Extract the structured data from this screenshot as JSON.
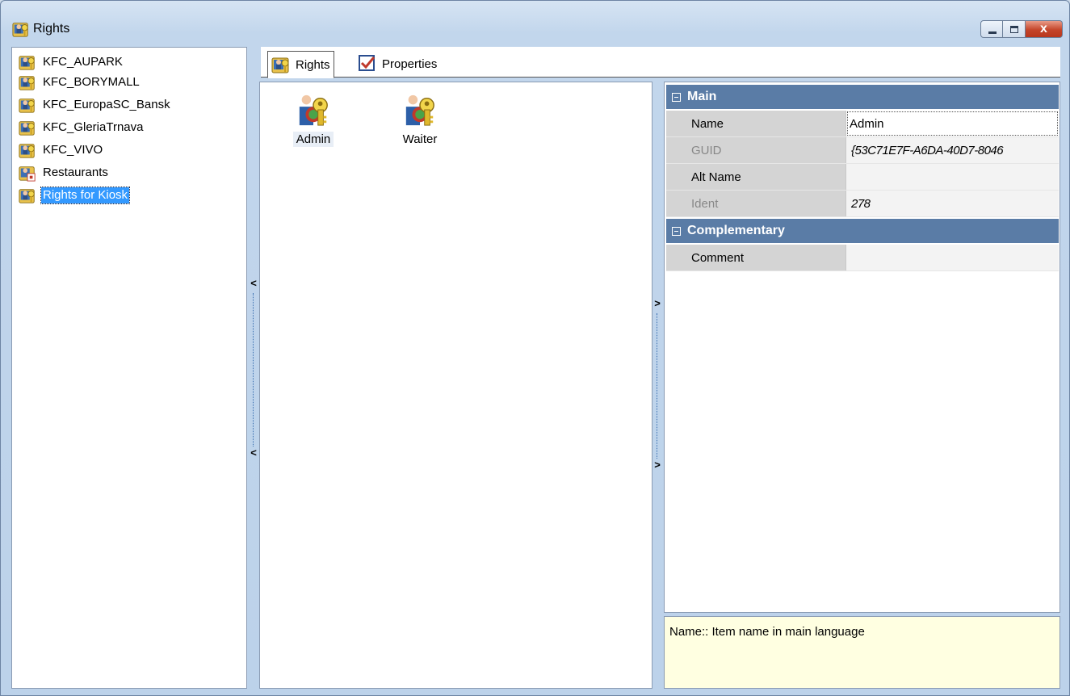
{
  "window": {
    "title": "Rights",
    "close_glyph": "x"
  },
  "tree": {
    "items": [
      {
        "label": "KFC_AUPARK",
        "icon": "rights-folder-icon"
      },
      {
        "label": "KFC_BORYMALL",
        "icon": "rights-folder-icon"
      },
      {
        "label": "KFC_EuropaSC_Bansk",
        "icon": "rights-folder-icon"
      },
      {
        "label": "KFC_GleriaTrnava",
        "icon": "rights-folder-icon"
      },
      {
        "label": "KFC_VIVO",
        "icon": "rights-folder-icon"
      },
      {
        "label": "Restaurants",
        "icon": "restaurants-folder-icon"
      },
      {
        "label": "Rights for Kiosk",
        "icon": "rights-folder-icon",
        "selected": true
      }
    ]
  },
  "tabs": [
    {
      "label": "Rights",
      "icon": "rights-icon",
      "active": true
    },
    {
      "label": "Properties",
      "icon": "properties-checkbox-icon",
      "active": false
    }
  ],
  "list": {
    "items": [
      {
        "label": "Admin",
        "icon": "user-key-icon"
      },
      {
        "label": "Waiter",
        "icon": "user-key-icon"
      }
    ]
  },
  "propgrid": {
    "categories": [
      {
        "name": "Main",
        "rows": [
          {
            "name": "Name",
            "value": "Admin",
            "readonly": false
          },
          {
            "name": "GUID",
            "value": "{53C71E7F-A6DA-40D7-8046",
            "readonly": true
          },
          {
            "name": "Alt Name",
            "value": "",
            "readonly": false
          },
          {
            "name": "Ident",
            "value": "278",
            "readonly": true
          }
        ]
      },
      {
        "name": "Complementary",
        "rows": [
          {
            "name": "Comment",
            "value": "",
            "readonly": false
          }
        ]
      }
    ],
    "help_text": "Name:: Item name in main language"
  },
  "splitters": {
    "left_arrow": "<",
    "right_arrow": ">"
  },
  "colors": {
    "category_header": "#5a7ca6",
    "selection": "#3399ff",
    "help_background": "#ffffe1"
  }
}
